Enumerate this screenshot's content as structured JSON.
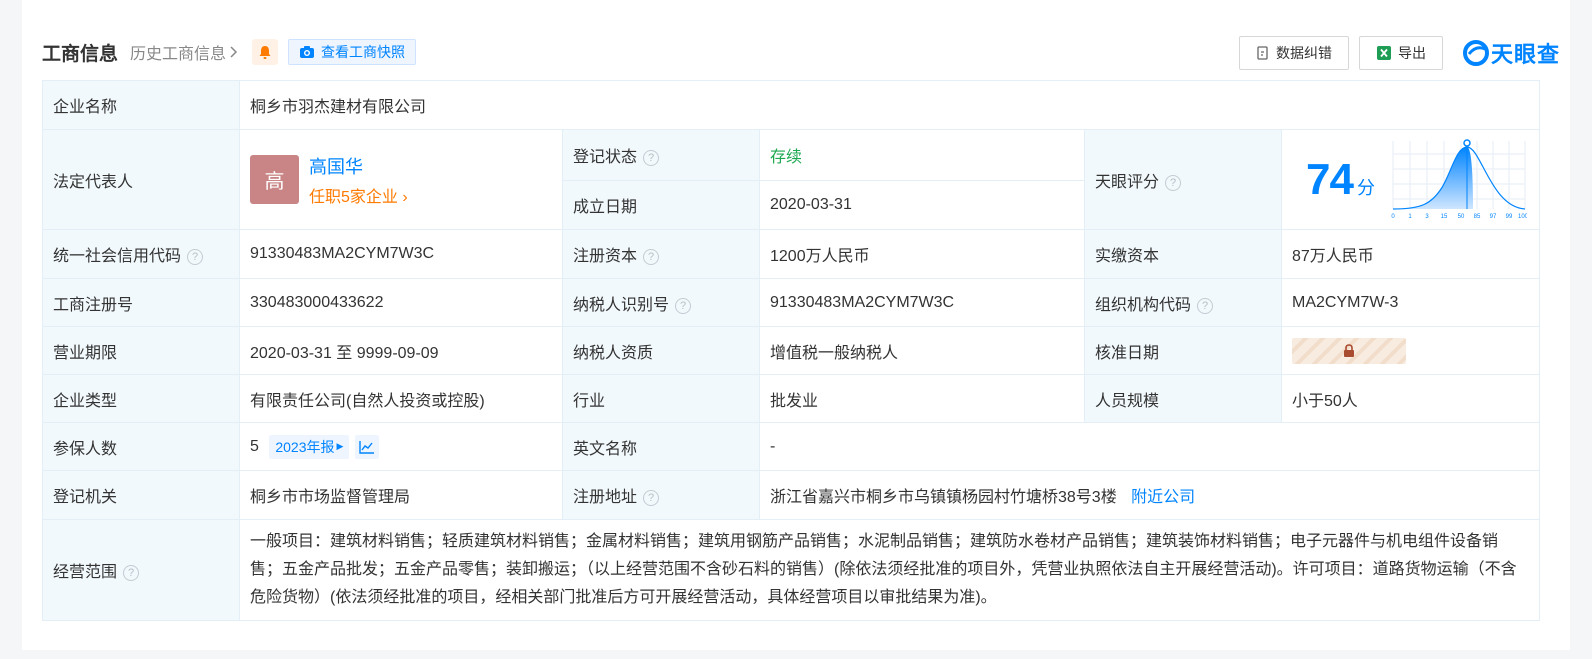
{
  "header": {
    "title": "工商信息",
    "history_label": "历史工商信息",
    "snapshot_label": "查看工商快照",
    "error_button": "数据纠错",
    "export_button": "导出",
    "brand": "天眼查"
  },
  "company": {
    "name_label": "企业名称",
    "name": "桐乡市羽杰建材有限公司",
    "legal_label": "法定代表人",
    "legal_avatar": "高",
    "legal_name": "高国华",
    "legal_roles": "任职5家企业",
    "status_label": "登记状态",
    "status": "存续",
    "founded_label": "成立日期",
    "founded": "2020-03-31",
    "score_label": "天眼评分",
    "score": "74",
    "score_unit": "分",
    "score_ticks": [
      "0",
      "1",
      "3",
      "15",
      "50",
      "85",
      "97",
      "99",
      "100"
    ],
    "credit_label": "统一社会信用代码",
    "credit": "91330483MA2CYM7W3C",
    "capital_label": "注册资本",
    "capital": "1200万人民币",
    "paid_label": "实缴资本",
    "paid": "87万人民币",
    "reg_label": "工商注册号",
    "reg": "330483000433622",
    "tax_label": "纳税人识别号",
    "tax": "91330483MA2CYM7W3C",
    "org_label": "组织机构代码",
    "org": "MA2CYM7W-3",
    "term_label": "营业期限",
    "term": "2020-03-31 至 9999-09-09",
    "taxq_label": "纳税人资质",
    "taxq": "增值税一般纳税人",
    "approve_label": "核准日期",
    "type_label": "企业类型",
    "type": "有限责任公司(自然人投资或控股)",
    "industry_label": "行业",
    "industry": "批发业",
    "staff_label": "人员规模",
    "staff": "小于50人",
    "insured_label": "参保人数",
    "insured": "5",
    "insured_report": "2023年报",
    "en_label": "英文名称",
    "en": "-",
    "authority_label": "登记机关",
    "authority": "桐乡市市场监督管理局",
    "address_label": "注册地址",
    "address": "浙江省嘉兴市桐乡市乌镇镇杨园村竹塘桥38号3楼",
    "nearby": "附近公司",
    "scope_label": "经营范围",
    "scope": "一般项目：建筑材料销售；轻质建筑材料销售；金属材料销售；建筑用钢筋产品销售；水泥制品销售；建筑防水卷材产品销售；建筑装饰材料销售；电子元器件与机电组件设备销售；五金产品批发；五金产品零售；装卸搬运；（以上经营范围不含砂石料的销售）(除依法须经批准的项目外，凭营业执照依法自主开展经营活动)。许可项目：道路货物运输（不含危险货物）(依法须经批准的项目，经相关部门批准后方可开展经营活动，具体经营项目以审批结果为准)。"
  },
  "colors": {
    "accent": "#0084ff",
    "label_bg": "#f2f9fc",
    "status": "#1da851",
    "link_orange": "#ff7a00"
  }
}
